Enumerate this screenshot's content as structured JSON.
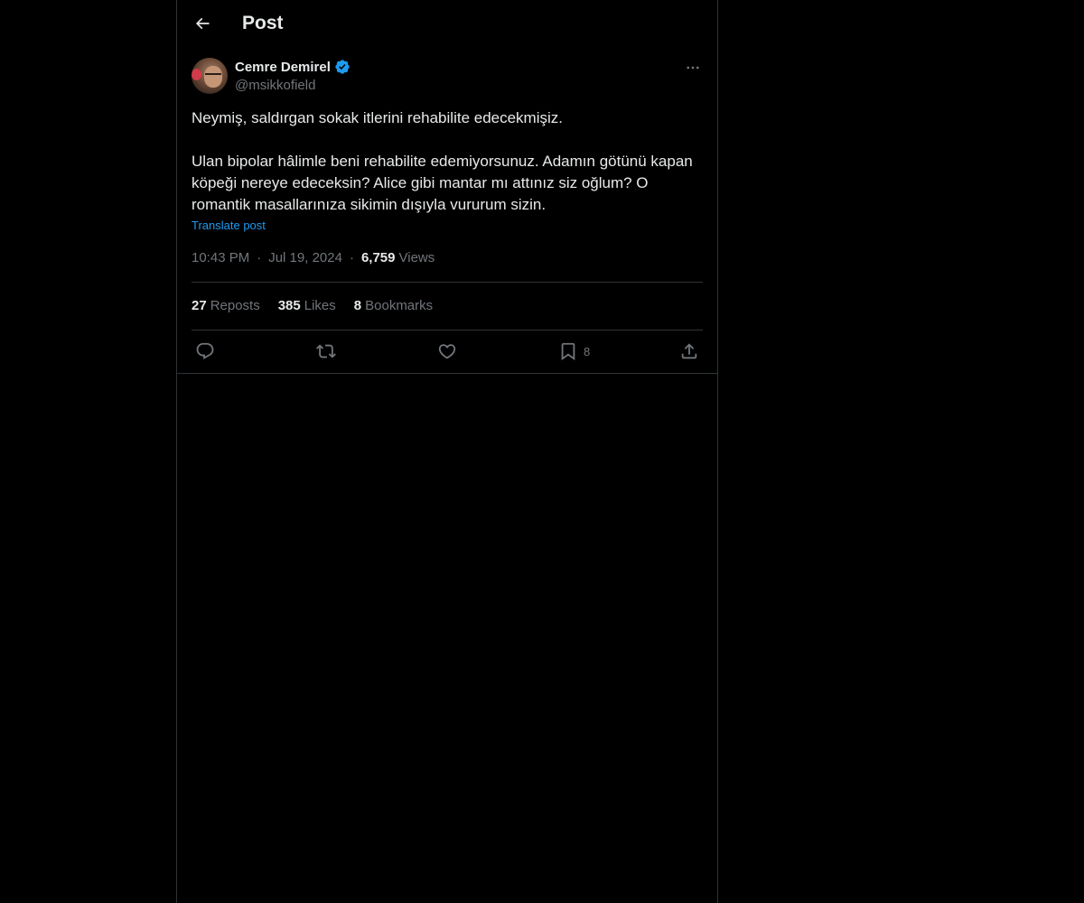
{
  "header": {
    "title": "Post",
    "back_icon": "arrow-left-icon"
  },
  "author": {
    "display_name": "Cemre Demirel",
    "handle": "@msikkofield",
    "verified": true,
    "verified_color": "#1d9bf0"
  },
  "post": {
    "paragraphs": [
      "Neymiş, saldırgan sokak itlerini rehabilite edecekmişiz.",
      "Ulan bipolar hâlimle beni rehabilite edemiyorsunuz. Adamın götünü kapan köpeği nereye edeceksin? Alice gibi mantar mı attınız siz oğlum? O romantik masallarınıza sikimin dışıyla vururum sizin."
    ],
    "translate_label": "Translate post",
    "time": "10:43 PM",
    "date": "Jul 19, 2024",
    "views_count": "6,759",
    "views_label": "Views"
  },
  "stats": {
    "reposts_count": "27",
    "reposts_label": "Reposts",
    "likes_count": "385",
    "likes_label": "Likes",
    "bookmarks_count": "8",
    "bookmarks_label": "Bookmarks"
  },
  "actions": {
    "bookmark_count": "8"
  },
  "colors": {
    "background": "#000000",
    "text": "#e7e9ea",
    "muted": "#71767b",
    "accent": "#1d9bf0",
    "border": "#2f3336"
  }
}
